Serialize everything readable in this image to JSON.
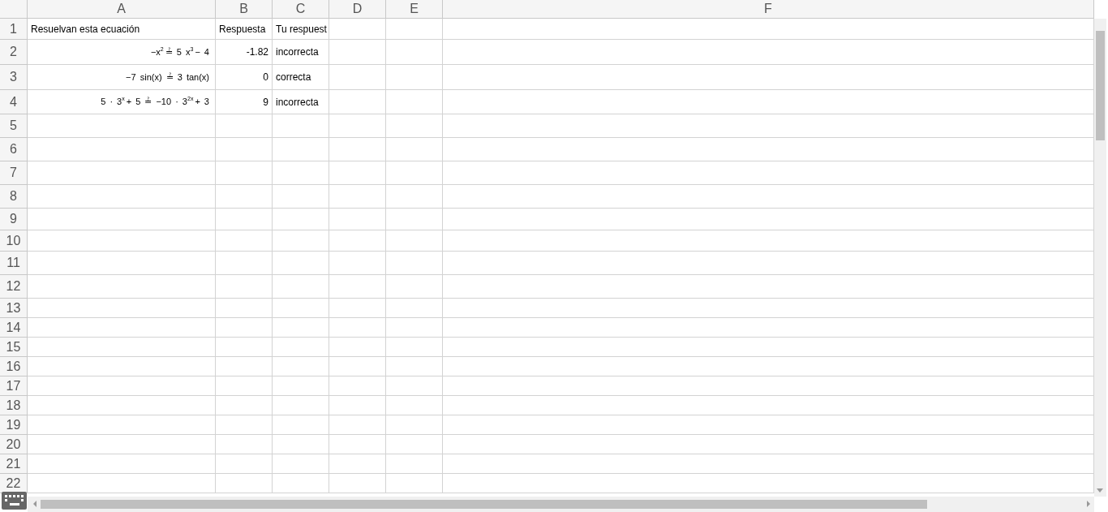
{
  "columns": [
    "A",
    "B",
    "C",
    "D",
    "E",
    "F"
  ],
  "rows": [
    {
      "number": "1",
      "cells": [
        {
          "kind": "text",
          "text": "Resuelvan esta ecuación"
        },
        {
          "kind": "text",
          "text": "Respuesta"
        },
        {
          "kind": "text",
          "text": "Tu respuest"
        }
      ]
    },
    {
      "number": "2",
      "cells": [
        {
          "kind": "formula",
          "text": "−x$^{2}$ ≟ 5 x$^{3}$ − 4"
        },
        {
          "kind": "number",
          "text": "-1.82"
        },
        {
          "kind": "text",
          "text": "incorrecta"
        }
      ]
    },
    {
      "number": "3",
      "cells": [
        {
          "kind": "formula",
          "text": "−7 sin(x) ≟ 3 tan(x)"
        },
        {
          "kind": "number",
          "text": "0"
        },
        {
          "kind": "text",
          "text": "correcta"
        }
      ]
    },
    {
      "number": "4",
      "cells": [
        {
          "kind": "formula",
          "text": "5 · 3$^{x}$ + 5 ≟ −10 · 3$^{2x}$ + 3"
        },
        {
          "kind": "number",
          "text": "9"
        },
        {
          "kind": "text",
          "text": "incorrecta"
        }
      ]
    },
    {
      "number": "5",
      "cells": []
    },
    {
      "number": "6",
      "cells": []
    },
    {
      "number": "7",
      "cells": []
    },
    {
      "number": "8",
      "cells": []
    },
    {
      "number": "9",
      "cells": []
    },
    {
      "number": "10",
      "cells": []
    },
    {
      "number": "11",
      "cells": []
    },
    {
      "number": "12",
      "cells": []
    },
    {
      "number": "13",
      "cells": []
    },
    {
      "number": "14",
      "cells": []
    },
    {
      "number": "15",
      "cells": []
    },
    {
      "number": "16",
      "cells": []
    },
    {
      "number": "17",
      "cells": []
    },
    {
      "number": "18",
      "cells": []
    },
    {
      "number": "19",
      "cells": []
    },
    {
      "number": "20",
      "cells": []
    },
    {
      "number": "21",
      "cells": []
    },
    {
      "number": "22",
      "cells": []
    }
  ]
}
